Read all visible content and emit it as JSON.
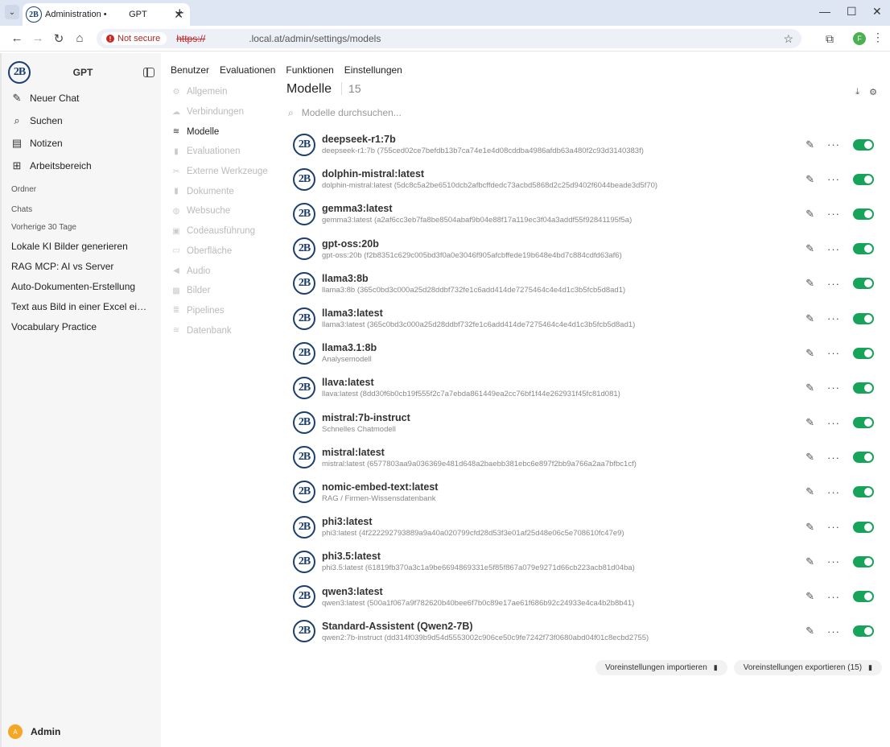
{
  "browser": {
    "tab_title": "Administration •         GPT",
    "url_scheme": "https://",
    "url_host": ".local.at",
    "url_path": "/admin/settings/models",
    "security_label": "Not secure",
    "profile_initial": "F",
    "favicon_text": "2B"
  },
  "sidebar": {
    "brand": "GPT",
    "logo_text": "2B",
    "nav": [
      {
        "label": "Neuer Chat",
        "icon": "edit-icon"
      },
      {
        "label": "Suchen",
        "icon": "search-icon"
      },
      {
        "label": "Notizen",
        "icon": "notes-icon"
      },
      {
        "label": "Arbeitsbereich",
        "icon": "workspace-icon"
      }
    ],
    "folders_label": "Ordner",
    "chats_label": "Chats",
    "recent_label": "Vorherige 30 Tage",
    "chats": [
      "Lokale KI Bilder generieren",
      "RAG MCP: AI vs Server",
      "Auto-Dokumenten-Erstellung",
      "Text aus Bild in einer Excel einf...",
      "Vocabulary Practice"
    ],
    "user_initial": "A",
    "user_name": "Admin"
  },
  "topnav": [
    "Benutzer",
    "Evaluationen",
    "Funktionen",
    "Einstellungen"
  ],
  "settings_nav": [
    {
      "label": "Allgemein",
      "icon": "gear-icon",
      "active": false
    },
    {
      "label": "Verbindungen",
      "icon": "cloud-icon",
      "active": false
    },
    {
      "label": "Modelle",
      "icon": "database-icon",
      "active": true
    },
    {
      "label": "Evaluationen",
      "icon": "document-icon",
      "active": false
    },
    {
      "label": "Externe Werkzeuge",
      "icon": "wrench-icon",
      "active": false
    },
    {
      "label": "Dokumente",
      "icon": "document-icon",
      "active": false
    },
    {
      "label": "Websuche",
      "icon": "globe-icon",
      "active": false
    },
    {
      "label": "Codeausführung",
      "icon": "code-icon",
      "active": false
    },
    {
      "label": "Oberfläche",
      "icon": "monitor-icon",
      "active": false
    },
    {
      "label": "Audio",
      "icon": "speaker-icon",
      "active": false
    },
    {
      "label": "Bilder",
      "icon": "image-icon",
      "active": false
    },
    {
      "label": "Pipelines",
      "icon": "layers-icon",
      "active": false
    },
    {
      "label": "Datenbank",
      "icon": "database-icon",
      "active": false
    }
  ],
  "models": {
    "title": "Modelle",
    "count": "15",
    "search_placeholder": "Modelle durchsuchen...",
    "items": [
      {
        "name": "deepseek-r1:7b",
        "desc": "deepseek-r1:7b (755ced02ce7befdb13b7ca74e1e4d08cddba4986afdb63a480f2c93d3140383f)",
        "enabled": true
      },
      {
        "name": "dolphin-mistral:latest",
        "desc": "dolphin-mistral:latest (5dc8c5a2be6510dcb2afbcffdedc73acbd5868d2c25d9402f6044beade3d5f70)",
        "enabled": true
      },
      {
        "name": "gemma3:latest",
        "desc": "gemma3:latest (a2af6cc3eb7fa8be8504abaf9b04e88f17a119ec3f04a3addf55f92841195f5a)",
        "enabled": true
      },
      {
        "name": "gpt-oss:20b",
        "desc": "gpt-oss:20b (f2b8351c629c005bd3f0a0e3046f905afcbffede19b648e4bd7c884cdfd63af6)",
        "enabled": true
      },
      {
        "name": "llama3:8b",
        "desc": "llama3:8b (365c0bd3c000a25d28ddbf732fe1c6add414de7275464c4e4d1c3b5fcb5d8ad1)",
        "enabled": true
      },
      {
        "name": "llama3:latest",
        "desc": "llama3:latest (365c0bd3c000a25d28ddbf732fe1c6add414de7275464c4e4d1c3b5fcb5d8ad1)",
        "enabled": true
      },
      {
        "name": "llama3.1:8b",
        "desc": "Analysemodell",
        "enabled": true
      },
      {
        "name": "llava:latest",
        "desc": "llava:latest (8dd30f6b0cb19f555f2c7a7ebda861449ea2cc76bf1f44e262931f45fc81d081)",
        "enabled": true
      },
      {
        "name": "mistral:7b-instruct",
        "desc": "Schnelles Chatmodell",
        "enabled": true
      },
      {
        "name": "mistral:latest",
        "desc": "mistral:latest (6577803aa9a036369e481d648a2baebb381ebc6e897f2bb9a766a2aa7bfbc1cf)",
        "enabled": true
      },
      {
        "name": "nomic-embed-text:latest",
        "desc": "RAG / Firmen-Wissensdatenbank",
        "enabled": true
      },
      {
        "name": "phi3:latest",
        "desc": "phi3:latest (4f222292793889a9a40a020799cfd28d53f3e01af25d48e06c5e708610fc47e9)",
        "enabled": true
      },
      {
        "name": "phi3.5:latest",
        "desc": "phi3.5:latest (61819fb370a3c1a9be6694869331e5f85f867a079e9271d66cb223acb81d04ba)",
        "enabled": true
      },
      {
        "name": "qwen3:latest",
        "desc": "qwen3:latest (500a1f067a9f782620b40bee6f7b0c89e17ae61f686b92c24933e4ca4b2b8b41)",
        "enabled": true
      },
      {
        "name": "Standard-Assistent (Qwen2-7B)",
        "desc": "qwen2:7b-instruct (dd314f039b9d54d5553002c906ce50c9fe7242f73f0680abd04f01c8ecbd2755)",
        "enabled": true
      }
    ],
    "import_label": "Voreinstellungen importieren",
    "export_label": "Voreinstellungen exportieren (15)"
  },
  "colors": {
    "toggle_on": "#18a35a",
    "logo": "#1c3f6e",
    "sidebar_bg": "#f6f6f6"
  }
}
